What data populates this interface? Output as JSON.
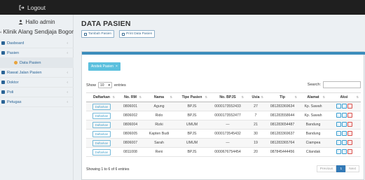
{
  "topbar": {
    "logout_label": "Logout"
  },
  "sidebar": {
    "greeting": "Hallo admin",
    "app_name": "Klinik Alang Sendjaja Bogor",
    "items": [
      {
        "label": "Dasboard",
        "icon": "dashboard-icon",
        "expandable": true
      },
      {
        "label": "Pasien",
        "icon": "patient-icon",
        "expandable": true
      },
      {
        "label": "Data Pasien",
        "icon": "users-icon",
        "expandable": false,
        "sub": true
      },
      {
        "label": "Rawat Jalan Pasien",
        "icon": "outpatient-icon",
        "expandable": true
      },
      {
        "label": "Doktor",
        "icon": "doctor-icon",
        "expandable": true
      },
      {
        "label": "Poli",
        "icon": "clinic-icon",
        "expandable": true
      },
      {
        "label": "Petugas",
        "icon": "staff-icon",
        "expandable": true
      }
    ]
  },
  "main": {
    "title": "DATA PASIEN",
    "add_button": "Tambah Pasien",
    "print_button": "Print Data Pasien",
    "panel_button": "Arsitek Pasien",
    "show_label": "Show",
    "entries_value": "10",
    "entries_label": "entries",
    "search_label": "Search:",
    "columns": [
      "Daftarkan",
      "No. RM",
      "Nama",
      "Tipe Pasien",
      "No. BPJS",
      "Usia",
      "Tlp",
      "Alamat",
      "Aksi"
    ],
    "register_label": "Daftarkan",
    "rows": [
      {
        "rm": "0806001",
        "nama": "Agung",
        "tipe": "BPJS",
        "bpjs": "0000173552433",
        "usia": "27",
        "tlp": "081283369634",
        "alamat": "Kp. Sawah"
      },
      {
        "rm": "0806002",
        "nama": "Rido",
        "tipe": "BPJS",
        "bpjs": "0000173552477",
        "usia": "7",
        "tlp": "081283558644",
        "alamat": "Kp. Sawah"
      },
      {
        "rm": "0806004",
        "nama": "Rizki",
        "tipe": "UMUM",
        "bpjs": "—",
        "usia": "21",
        "tlp": "081283654487",
        "alamat": "Bandung"
      },
      {
        "rm": "0806005",
        "nama": "Kapten Budi",
        "tipe": "BPJS",
        "bpjs": "0000173545432",
        "usia": "30",
        "tlp": "081283369637",
        "alamat": "Bandung"
      },
      {
        "rm": "0806007",
        "nama": "Sarah",
        "tipe": "UMUM",
        "bpjs": "—",
        "usia": "19",
        "tlp": "081283365764",
        "alamat": "Ciampea"
      },
      {
        "rm": "0811008",
        "nama": "Reni",
        "tipe": "BPJS",
        "bpjs": "0000676754454",
        "usia": "20",
        "tlp": "087845444456",
        "alamat": "Cilandak"
      }
    ],
    "info": "Showing 1 to 6 of 6 entries",
    "pager": {
      "previous": "Previous",
      "page": "1",
      "next": "Next"
    }
  },
  "colors": {
    "topbar": "#1f1f1f",
    "accent": "#3c8dbc",
    "info_button": "#5bc0de",
    "page_active": "#337ab7"
  }
}
